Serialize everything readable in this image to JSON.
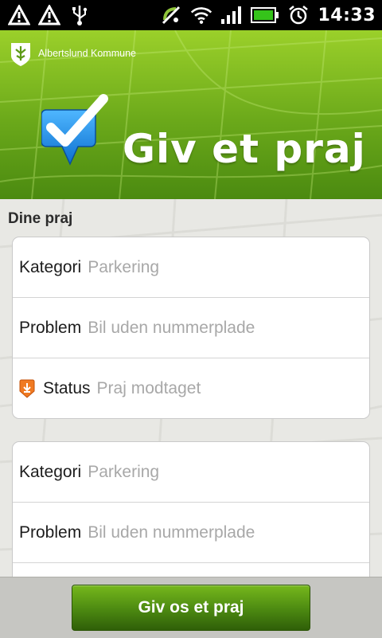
{
  "status_bar": {
    "time": "14:33",
    "left_icons": [
      "warning-icon",
      "warning-icon",
      "usb-icon"
    ],
    "right_icons": [
      "mute-icon",
      "wifi-icon",
      "signal-icon",
      "battery-icon",
      "alarm-icon"
    ]
  },
  "header": {
    "municipality": "Albertslund Kommune",
    "app_title": "Giv et praj",
    "colors": {
      "green_light": "#9bd02a",
      "green_dark": "#4b8a10"
    }
  },
  "section_title": "Dine praj",
  "cards": [
    {
      "rows": [
        {
          "label": "Kategori",
          "value": "Parkering"
        },
        {
          "label": "Problem",
          "value": "Bil uden nummerplade"
        },
        {
          "label": "Status",
          "value": "Praj modtaget",
          "icon": "status-received-icon"
        }
      ]
    },
    {
      "rows": [
        {
          "label": "Kategori",
          "value": "Parkering"
        },
        {
          "label": "Problem",
          "value": "Bil uden nummerplade"
        },
        {
          "label": "",
          "value": ""
        }
      ]
    }
  ],
  "cta_button": "Giv os et praj"
}
